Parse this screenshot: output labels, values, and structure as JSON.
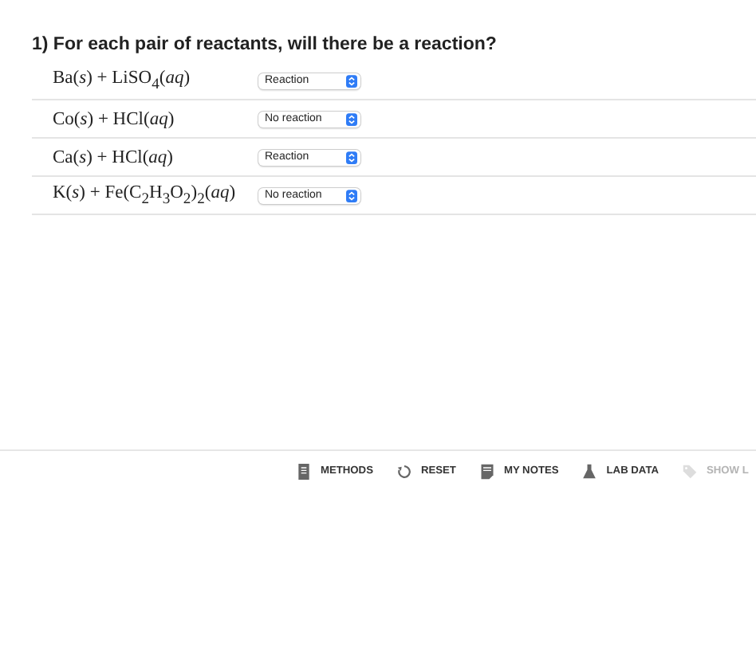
{
  "question": {
    "title": "1) For each pair of reactants, will there be a reaction?",
    "rows": [
      {
        "reactants": "Ba(*s*) + LiSO$_{4}$(*aq*)",
        "answer": "Reaction"
      },
      {
        "reactants": "Co(*s*) + HCl(*aq*)",
        "answer": "No reaction"
      },
      {
        "reactants": "Ca(*s*) + HCl(*aq*)",
        "answer": "Reaction"
      },
      {
        "reactants": "K(*s*) + Fe(C$_{2}$H$_{3}$O$_{2}$)$_{2}$(*aq*)",
        "answer": "No reaction"
      }
    ]
  },
  "toolbar": [
    {
      "kind": "methods",
      "label": "METHODS",
      "disabled": false
    },
    {
      "kind": "reset",
      "label": "RESET",
      "disabled": false
    },
    {
      "kind": "notes",
      "label": "MY NOTES",
      "disabled": false
    },
    {
      "kind": "labdata",
      "label": "LAB DATA",
      "disabled": false
    },
    {
      "kind": "show",
      "label": "SHOW L",
      "disabled": true
    }
  ]
}
